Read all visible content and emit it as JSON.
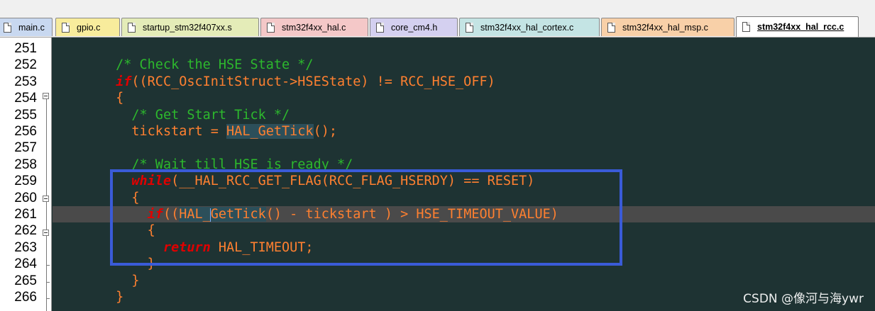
{
  "tabs": [
    {
      "label": "main.c",
      "color": "#c8d8f0",
      "active": false
    },
    {
      "label": "gpio.c",
      "color": "#f8ec9c",
      "active": false
    },
    {
      "label": "startup_stm32f407xx.s",
      "color": "#e4ecb8",
      "active": false
    },
    {
      "label": "stm32f4xx_hal.c",
      "color": "#f4c8c8",
      "active": false
    },
    {
      "label": "core_cm4.h",
      "color": "#d4d0f0",
      "active": false
    },
    {
      "label": "stm32f4xx_hal_cortex.c",
      "color": "#c4e4e4",
      "active": false
    },
    {
      "label": "stm32f4xx_hal_msp.c",
      "color": "#f8d0a8",
      "active": false
    },
    {
      "label": "stm32f4xx_hal_rcc.c",
      "color": "#ffffff",
      "active": true
    }
  ],
  "line_numbers": [
    "251",
    "252",
    "253",
    "254",
    "255",
    "256",
    "257",
    "258",
    "259",
    "260",
    "261",
    "262",
    "263",
    "264",
    "265",
    "266"
  ],
  "code": [
    {
      "ln": "251",
      "segs": []
    },
    {
      "ln": "252",
      "segs": [
        {
          "t": "        ",
          "c": ""
        },
        {
          "t": "/* Check the HSE State */",
          "c": "cm"
        }
      ]
    },
    {
      "ln": "253",
      "segs": [
        {
          "t": "        ",
          "c": ""
        },
        {
          "t": "if",
          "c": "kw"
        },
        {
          "t": "((RCC_OscInitStruct->HSEState) != RCC_HSE_OFF)",
          "c": "tx"
        }
      ]
    },
    {
      "ln": "254",
      "segs": [
        {
          "t": "        ",
          "c": ""
        },
        {
          "t": "{",
          "c": "tx"
        }
      ]
    },
    {
      "ln": "255",
      "segs": [
        {
          "t": "          ",
          "c": ""
        },
        {
          "t": "/* Get Start Tick */",
          "c": "cm"
        }
      ]
    },
    {
      "ln": "256",
      "segs": [
        {
          "t": "          ",
          "c": ""
        },
        {
          "t": "tickstart = ",
          "c": "tx"
        },
        {
          "t": "HAL_GetTick",
          "c": "tx hb"
        },
        {
          "t": "();",
          "c": "tx"
        }
      ]
    },
    {
      "ln": "257",
      "segs": []
    },
    {
      "ln": "258",
      "segs": [
        {
          "t": "          ",
          "c": ""
        },
        {
          "t": "/* Wait till HSE is ready */",
          "c": "cm"
        }
      ]
    },
    {
      "ln": "259",
      "segs": [
        {
          "t": "          ",
          "c": ""
        },
        {
          "t": "while",
          "c": "kw"
        },
        {
          "t": "(__HAL_RCC_GET_FLAG(RCC_FLAG_HSERDY) == RESET)",
          "c": "tx"
        }
      ]
    },
    {
      "ln": "260",
      "segs": [
        {
          "t": "          ",
          "c": ""
        },
        {
          "t": "{",
          "c": "tx"
        }
      ]
    },
    {
      "ln": "261",
      "segs": [
        {
          "t": "            ",
          "c": ""
        },
        {
          "t": "if",
          "c": "kw"
        },
        {
          "t": "((",
          "c": "tx"
        },
        {
          "t": "HAL_",
          "c": "tx hb"
        },
        {
          "t": "|",
          "c": "caret"
        },
        {
          "t": "GetTick",
          "c": "tx hb"
        },
        {
          "t": "() - tickstart ) > HSE_TIMEOUT_VALUE)",
          "c": "tx"
        }
      ]
    },
    {
      "ln": "262",
      "segs": [
        {
          "t": "            ",
          "c": ""
        },
        {
          "t": "{",
          "c": "tx"
        }
      ]
    },
    {
      "ln": "263",
      "segs": [
        {
          "t": "              ",
          "c": ""
        },
        {
          "t": "return",
          "c": "kw"
        },
        {
          "t": " HAL_TIMEOUT;",
          "c": "tx"
        }
      ]
    },
    {
      "ln": "264",
      "segs": [
        {
          "t": "            ",
          "c": ""
        },
        {
          "t": "}",
          "c": "tx"
        }
      ]
    },
    {
      "ln": "265",
      "segs": [
        {
          "t": "          ",
          "c": ""
        },
        {
          "t": "}",
          "c": "tx"
        }
      ]
    },
    {
      "ln": "266",
      "segs": [
        {
          "t": "        ",
          "c": ""
        },
        {
          "t": "}",
          "c": "tx"
        }
      ]
    }
  ],
  "current_line": "261",
  "watermark": "CSDN @像河与海ywr"
}
